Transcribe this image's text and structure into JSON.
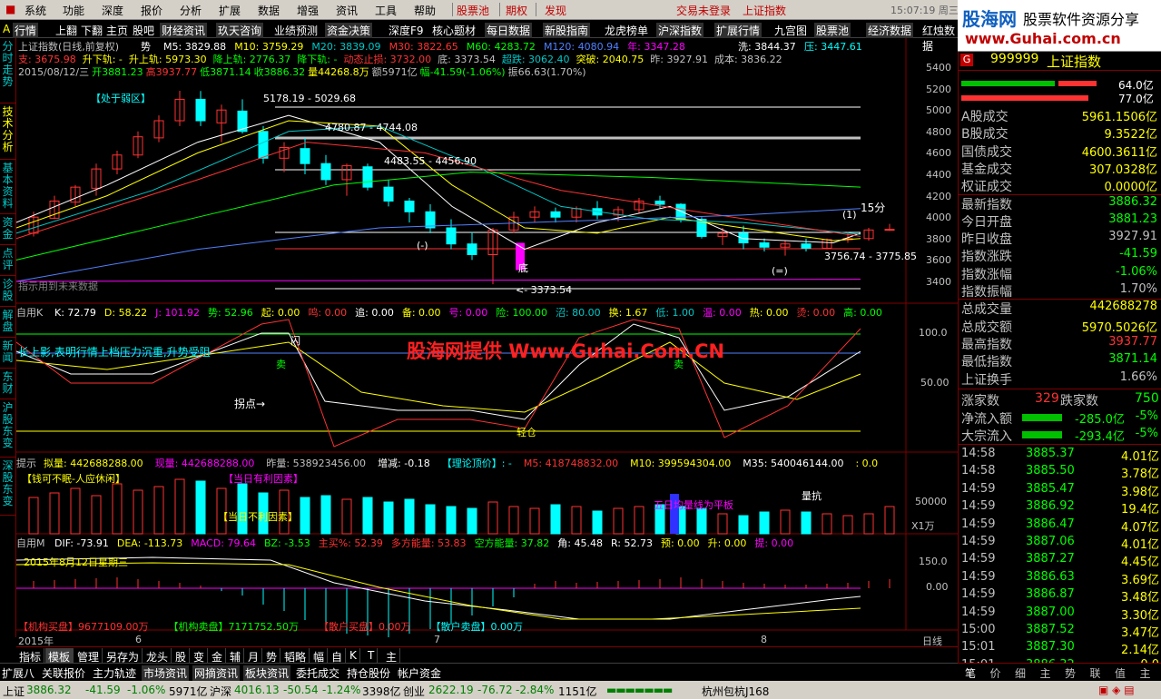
{
  "menu": {
    "items": [
      "系统",
      "功能",
      "深度",
      "报价",
      "分析",
      "扩展",
      "数据",
      "增强",
      "资讯",
      "工具",
      "帮助"
    ],
    "highlight_items": [
      "股票池",
      "期权",
      "发现"
    ],
    "trade_status": "交易未登录",
    "index_name": "上证指数",
    "clock": "15:07:19 周三"
  },
  "toolbar": {
    "items": [
      "行情",
      "上翻",
      "下翻",
      "主页",
      "股吧",
      "财经资讯",
      "玖天咨询",
      "业绩预测",
      "资金决策",
      "深度F9",
      "核心题材",
      "每日数据",
      "新股指南",
      "龙虎榜单",
      "沪深指数",
      "扩展行情",
      "九宫图",
      "股票池",
      "经济数据",
      "红烛数据"
    ]
  },
  "brand": {
    "logo": "股海网",
    "slogan": "股票软件资源分享",
    "url": "www.Guhai.com.cn"
  },
  "left_tabs": [
    "分时走势",
    "技术分析",
    "基本资料",
    "资金",
    "点评",
    "诊股",
    "解盘",
    "新闻",
    "东财",
    "沪股东变",
    "深股东变"
  ],
  "main_chart": {
    "title": "上证指数(日线,前复权)",
    "shi_label": "势",
    "ma": [
      {
        "label": "M5: 3829.88",
        "color": "#ffffff"
      },
      {
        "label": "M10: 3759.29",
        "color": "#ffff00"
      },
      {
        "label": "M20: 3839.09",
        "color": "#00c8c8"
      },
      {
        "label": "M30: 3822.65",
        "color": "#ff3232"
      },
      {
        "label": "M60: 4283.72",
        "color": "#00ff00"
      },
      {
        "label": "M120: 4080.94",
        "color": "#5080ff"
      },
      {
        "label": "年: 3347.28",
        "color": "#ff00ff"
      }
    ],
    "wash": "洗: 3844.37",
    "pressure": "压: 3447.61",
    "line2": [
      {
        "label": "支: 3675.98",
        "color": "#ff3232"
      },
      {
        "label": "升下轨: -",
        "color": "#ffff00"
      },
      {
        "label": "升上轨: 5973.30",
        "color": "#ffff00"
      },
      {
        "label": "降上轨: 2776.37",
        "color": "#00ff00"
      },
      {
        "label": "降下轨: -",
        "color": "#00ff00"
      },
      {
        "label": "动态止损: 3732.00",
        "color": "#ff3232"
      },
      {
        "label": "底: 3373.54",
        "color": "#c0c0c0"
      },
      {
        "label": "超跌: 3062.40",
        "color": "#00c8c8"
      },
      {
        "label": "突破: 2040.75",
        "color": "#ffff00"
      },
      {
        "label": "昨: 3927.91",
        "color": "#c0c0c0"
      },
      {
        "label": "成本: 3836.22",
        "color": "#c0c0c0"
      }
    ],
    "line3": [
      {
        "label": "2015/08/12/三",
        "color": "#c0c0c0"
      },
      {
        "label": "开3881.23",
        "color": "#00ff00"
      },
      {
        "label": "高3937.77",
        "color": "#ff3232"
      },
      {
        "label": "低3871.14",
        "color": "#00ff00"
      },
      {
        "label": "收3886.32",
        "color": "#00ff00"
      },
      {
        "label": "量44268.8万",
        "color": "#ffff00"
      },
      {
        "label": "额5971亿",
        "color": "#c0c0c0"
      },
      {
        "label": "幅-41.59(-1.06%)",
        "color": "#00ff00"
      },
      {
        "label": "振66.63(1.70%)",
        "color": "#c0c0c0"
      }
    ],
    "annotations": {
      "weak": "【处于弱区】",
      "level1": "5178.19 - 5029.68",
      "level2": "4780.87 - 4744.08",
      "level3": "4483.55 - 4456.90",
      "level4": "3756.74 - 3775.85",
      "bottom_low": "<- 3373.54",
      "future": "指示用到未来数据",
      "di": "底",
      "min15": "15分",
      "circ1": "(-)",
      "circ2": "(=)",
      "circ3": "(1)"
    },
    "y_ticks": [
      "5400",
      "5200",
      "5000",
      "4800",
      "4600",
      "4400",
      "4200",
      "4000",
      "3800",
      "3600",
      "3400"
    ]
  },
  "kdj": {
    "title": "自用K",
    "params": [
      {
        "label": "K: 72.79",
        "color": "#ffffff"
      },
      {
        "label": "D: 58.22",
        "color": "#ffff00"
      },
      {
        "label": "J: 101.92",
        "color": "#ff00ff"
      },
      {
        "label": "势: 52.96",
        "color": "#00ff00"
      },
      {
        "label": "起: 0.00",
        "color": "#ffff00"
      },
      {
        "label": "鸣: 0.00",
        "color": "#ff3232"
      },
      {
        "label": "追: 0.00",
        "color": "#ffffff"
      },
      {
        "label": "备: 0.00",
        "color": "#ffff00"
      },
      {
        "label": "号: 0.00",
        "color": "#ff00ff"
      },
      {
        "label": "险: 100.00",
        "color": "#00ff00"
      },
      {
        "label": "沼: 80.00",
        "color": "#00c8c8"
      },
      {
        "label": "换: 1.67",
        "color": "#ffff00"
      },
      {
        "label": "低: 1.00",
        "color": "#00c8c8"
      },
      {
        "label": "温: 0.00",
        "color": "#ff00ff"
      },
      {
        "label": "热: 0.00",
        "color": "#ffff00"
      },
      {
        "label": "烫: 0.00",
        "color": "#ff3232"
      },
      {
        "label": "高: 0.00",
        "color": "#00ff00"
      }
    ],
    "note": "长上影,表明行情上档压力沉重,升势受阻",
    "turn": "拐点→",
    "sell1": "卖",
    "sell2": "卖",
    "flash": "闪",
    "light": "轻仓",
    "watermark": "股海网提供 Www.Guhai.Com.CN",
    "y_ticks": [
      "100.0",
      "50.00"
    ]
  },
  "volume": {
    "prompt": "提示",
    "params": [
      {
        "label": "拟量: 442688288.00",
        "color": "#ffff00"
      },
      {
        "label": "现量: 442688288.00",
        "color": "#ff00ff"
      },
      {
        "label": "昨量: 538923456.00",
        "color": "#c0c0c0"
      },
      {
        "label": "增减: -0.18",
        "color": "#ffffff"
      },
      {
        "label": "【理论顶价】: -",
        "color": "#00ffff"
      },
      {
        "label": "M5: 418748832.00",
        "color": "#ff3232"
      },
      {
        "label": "M10: 399594304.00",
        "color": "#ffff00"
      },
      {
        "label": "M35: 540046144.00",
        "color": "#ffffff"
      },
      {
        "label": ": 0.0",
        "color": "#ffff00"
      }
    ],
    "tags": {
      "t1": "【钱可不眠-人应休闲】",
      "t2": "【当日有利因素】",
      "t3": "【当日不利因素】",
      "t4": "量抗",
      "t5": "五日均量线为平板"
    },
    "y_ticks": [
      "50000"
    ],
    "unit": "X1万"
  },
  "macd": {
    "title": "自用M",
    "params": [
      {
        "label": "DIF: -73.91",
        "color": "#ffffff"
      },
      {
        "label": "DEA: -113.73",
        "color": "#ffff00"
      },
      {
        "label": "MACD: 79.64",
        "color": "#ff00ff"
      },
      {
        "label": "BZ: -3.53",
        "color": "#00ff00"
      },
      {
        "label": "主买%: 52.39",
        "color": "#ff3232"
      },
      {
        "label": "多方能量: 53.83",
        "color": "#ff3232"
      },
      {
        "label": "空方能量: 37.82",
        "color": "#00ff00"
      },
      {
        "label": "角: 45.48",
        "color": "#ffffff"
      },
      {
        "label": "R: 52.73",
        "color": "#ffffff"
      },
      {
        "label": "预: 0.00",
        "color": "#ffff00"
      },
      {
        "label": "升: 0.00",
        "color": "#ffff00"
      },
      {
        "label": "提: 0.00",
        "color": "#ff00ff"
      }
    ],
    "date_note": "2015年8月12日星期三",
    "footer": [
      {
        "label": "【机构买盘】9677109.00万",
        "color": "#ff3232"
      },
      {
        "label": "【机构卖盘】7171752.50万",
        "color": "#00ff00"
      },
      {
        "label": "【散户买盘】0.00万",
        "color": "#ff3232"
      },
      {
        "label": "【散户卖盘】0.00万",
        "color": "#00ffff"
      }
    ],
    "y_ticks": [
      "150.0",
      "0.00"
    ]
  },
  "x_axis": {
    "labels": [
      "2015年",
      "6",
      "7",
      "8"
    ],
    "period": "日线"
  },
  "bottom_tabs": [
    "指标",
    "模板",
    "管理",
    "另存为",
    "龙头",
    "股",
    "变",
    "金",
    "辅",
    "月",
    "势",
    "韬略",
    "幅",
    "自",
    "K",
    "T",
    "主"
  ],
  "bottom_bar": [
    "扩展八",
    "关联报价",
    "主力轨迹",
    "市场资讯",
    "网摘资讯",
    "板块资讯",
    "委托成交",
    "持仓股份",
    "帐户资金"
  ],
  "right_panel": {
    "code": "999999",
    "name": "上证指数",
    "bar1": "64.0亿",
    "bar2": "77.0亿",
    "stats": [
      {
        "label": "A股成交",
        "value": "5961.1506亿",
        "color": "#ffff00"
      },
      {
        "label": "B股成交",
        "value": "9.3522亿",
        "color": "#ffff00"
      },
      {
        "label": "国债成交",
        "value": "4600.3611亿",
        "color": "#ffff00"
      },
      {
        "label": "基金成交",
        "value": "307.0328亿",
        "color": "#ffff00"
      },
      {
        "label": "权证成交",
        "value": "0.0000亿",
        "color": "#ffff00"
      },
      {
        "label": "最新指数",
        "value": "3886.32",
        "color": "#00ff00"
      },
      {
        "label": "今日开盘",
        "value": "3881.23",
        "color": "#00ff00"
      },
      {
        "label": "昨日收盘",
        "value": "3927.91",
        "color": "#c0c0c0"
      },
      {
        "label": "指数涨跌",
        "value": "-41.59",
        "color": "#00ff00"
      },
      {
        "label": "指数涨幅",
        "value": "-1.06%",
        "color": "#00ff00"
      },
      {
        "label": "指数振幅",
        "value": "1.70%",
        "color": "#c0c0c0"
      },
      {
        "label": "总成交量",
        "value": "442688278",
        "color": "#ffff00"
      },
      {
        "label": "总成交额",
        "value": "5970.5026亿",
        "color": "#ffff00"
      },
      {
        "label": "最高指数",
        "value": "3937.77",
        "color": "#ff3232"
      },
      {
        "label": "最低指数",
        "value": "3871.14",
        "color": "#00ff00"
      },
      {
        "label": "上证换手",
        "value": "1.66%",
        "color": "#c0c0c0"
      }
    ],
    "up_label": "涨家数",
    "up_value": "329",
    "down_label": "跌家数",
    "down_value": "750",
    "flow": [
      {
        "label": "净流入额",
        "value": "-285.0亿",
        "pct": "-5%"
      },
      {
        "label": "大宗流入",
        "value": "-293.4亿",
        "pct": "-5%"
      }
    ],
    "ticks": [
      {
        "time": "14:58",
        "price": "3885.37",
        "vol": "4.01亿"
      },
      {
        "time": "14:58",
        "price": "3885.50",
        "vol": "3.78亿"
      },
      {
        "time": "14:59",
        "price": "3885.47",
        "vol": "3.98亿"
      },
      {
        "time": "14:59",
        "price": "3886.92",
        "vol": "19.4亿"
      },
      {
        "time": "14:59",
        "price": "3886.47",
        "vol": "4.07亿"
      },
      {
        "time": "14:59",
        "price": "3887.06",
        "vol": "4.01亿"
      },
      {
        "time": "14:59",
        "price": "3887.27",
        "vol": "4.45亿"
      },
      {
        "time": "14:59",
        "price": "3886.63",
        "vol": "3.69亿"
      },
      {
        "time": "14:59",
        "price": "3886.87",
        "vol": "3.48亿"
      },
      {
        "time": "14:59",
        "price": "3887.00",
        "vol": "3.30亿"
      },
      {
        "time": "15:00",
        "price": "3887.52",
        "vol": "3.47亿"
      },
      {
        "time": "15:01",
        "price": "3887.30",
        "vol": "2.14亿"
      },
      {
        "time": "15:01",
        "price": "3886.32",
        "vol": "0.0"
      }
    ],
    "tabs": [
      "笔",
      "价",
      "细",
      "主",
      "势",
      "联",
      "值",
      "主"
    ]
  },
  "status": {
    "sh_label": "上证",
    "sh_val": "3886.32",
    "sh_chg": "-41.59",
    "sh_pct": "-1.06%",
    "sh_amt": "5971亿",
    "hs_label": "沪深",
    "hs_val": "4016.13",
    "hs_chg": "-50.54",
    "hs_pct": "-1.24%",
    "hs_amt": "3398亿",
    "cy_label": "创业",
    "cy_val": "2622.19",
    "cy_chg": "-76.72",
    "cy_pct": "-2.84%",
    "cy_amt": "1151亿",
    "server": "杭州包杭J168"
  }
}
